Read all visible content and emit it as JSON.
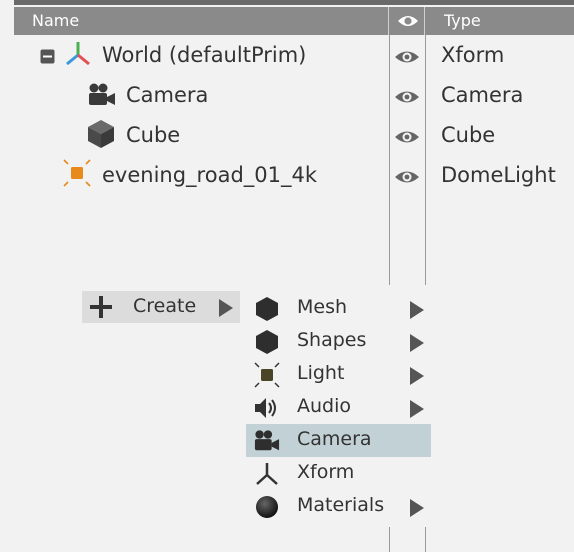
{
  "header": {
    "name_label": "Name",
    "type_label": "Type"
  },
  "rows": [
    {
      "label": "World (defaultPrim)",
      "type": "Xform",
      "icon": "xform-icon"
    },
    {
      "label": "Camera",
      "type": "Camera",
      "icon": "camera-icon"
    },
    {
      "label": "Cube",
      "type": "Cube",
      "icon": "cube-icon"
    },
    {
      "label": "evening_road_01_4k",
      "type": "DomeLight",
      "icon": "light-icon"
    }
  ],
  "context_menu": {
    "root_label": "Create",
    "items": [
      {
        "label": "Mesh",
        "icon": "mesh-icon",
        "has_submenu": true
      },
      {
        "label": "Shapes",
        "icon": "shapes-icon",
        "has_submenu": true
      },
      {
        "label": "Light",
        "icon": "light-icon",
        "has_submenu": true
      },
      {
        "label": "Audio",
        "icon": "audio-icon",
        "has_submenu": true
      },
      {
        "label": "Camera",
        "icon": "camera-icon",
        "has_submenu": false,
        "selected": true
      },
      {
        "label": "Xform",
        "icon": "xform-icon",
        "has_submenu": false
      },
      {
        "label": "Materials",
        "icon": "sphere-icon",
        "has_submenu": true
      }
    ]
  },
  "colors": {
    "selected_bg": "#c2d1d6",
    "light_accent": "#e8891c",
    "header_bg": "#8a8a8a"
  }
}
